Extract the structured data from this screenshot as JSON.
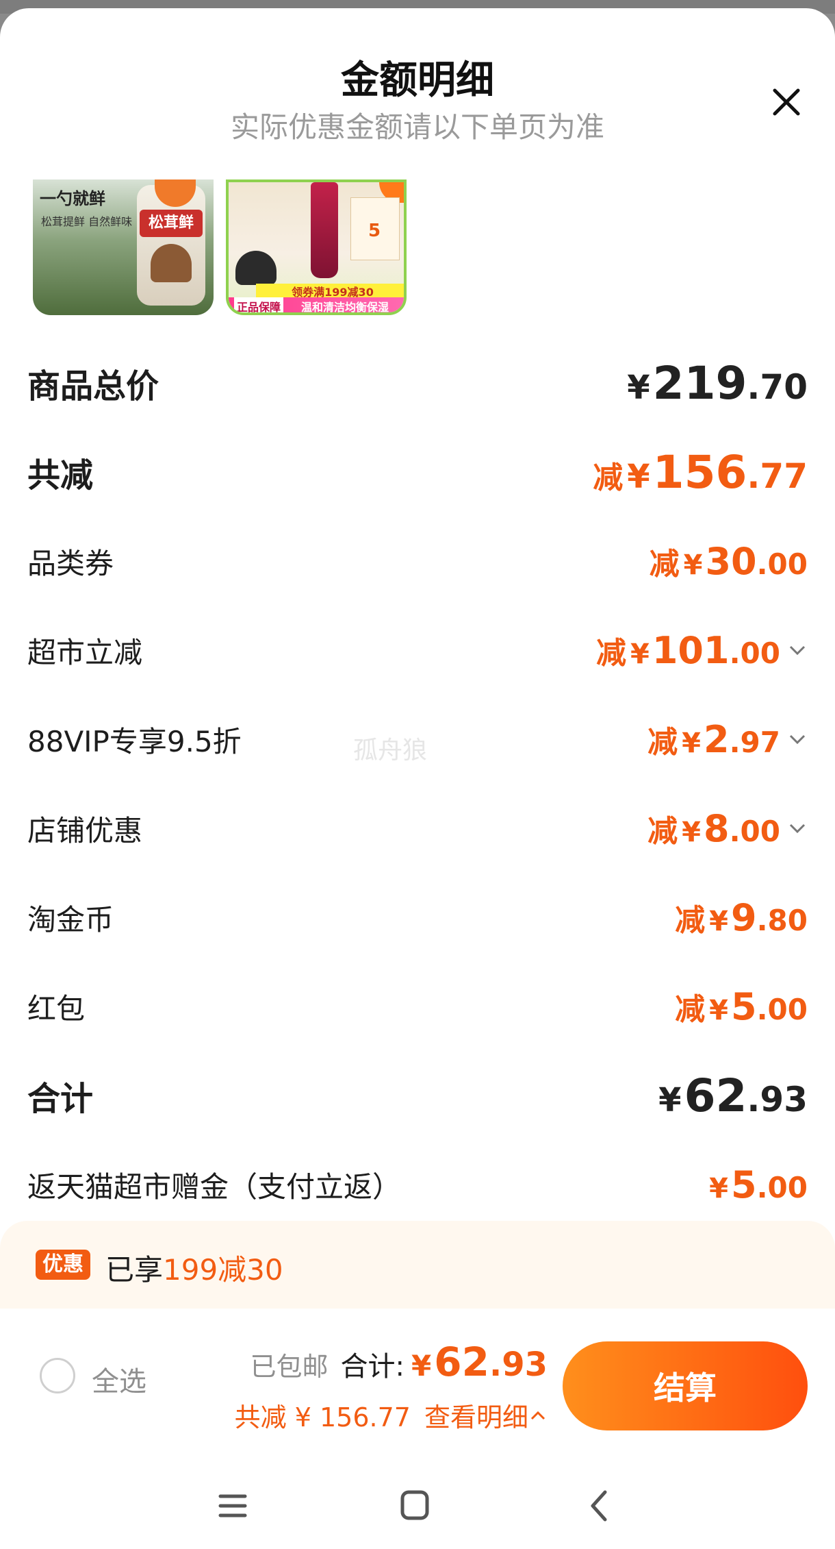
{
  "header": {
    "title": "金额明细",
    "subtitle": "实际优惠金额请以下单页为准"
  },
  "thumbnails": {
    "item1": {
      "label": "一勺就鲜",
      "sub": "松茸提鲜 自然鲜味",
      "product": "松茸鲜"
    },
    "item2": {
      "coupon_value": "5",
      "band": "领券满199减30",
      "tag": "正品保障",
      "slogan": "温和清洁均衡保湿"
    }
  },
  "rows": [
    {
      "label": "商品总价",
      "prefix": "",
      "yen": "¥",
      "int": "219",
      "dec": ".70"
    },
    {
      "label": "共减",
      "prefix": "减",
      "yen": "¥",
      "int": "156",
      "dec": ".77"
    },
    {
      "label": "品类券",
      "prefix": "减",
      "yen": "¥",
      "int": "30",
      "dec": ".00"
    },
    {
      "label": "超市立减",
      "prefix": "减",
      "yen": "¥",
      "int": "101",
      "dec": ".00"
    },
    {
      "label": "88VIP专享9.5折",
      "prefix": "减",
      "yen": "¥",
      "int": "2",
      "dec": ".97"
    },
    {
      "label": "店铺优惠",
      "prefix": "减",
      "yen": "¥",
      "int": "8",
      "dec": ".00"
    },
    {
      "label": "淘金币",
      "prefix": "减",
      "yen": "¥",
      "int": "9",
      "dec": ".80"
    },
    {
      "label": "红包",
      "prefix": "减",
      "yen": "¥",
      "int": "5",
      "dec": ".00"
    },
    {
      "label": "合计",
      "prefix": "",
      "yen": "¥",
      "int": "62",
      "dec": ".93"
    },
    {
      "label": "返天猫超市赠金（支付立返）",
      "prefix": "",
      "yen": "¥",
      "int": "5",
      "dec": ".00"
    }
  ],
  "watermark": "孤舟狼",
  "promo": {
    "tag": "优惠",
    "text": "已享",
    "highlight": "199减30"
  },
  "checkout": {
    "select_all": "全选",
    "shipping": "已包邮",
    "total_label": "合计:",
    "total_yen": "¥",
    "total_int": "62",
    "total_dec": ".93",
    "discount_text": "共减 ¥ 156.77",
    "detail_link": "查看明细",
    "button": "结算"
  },
  "nav": {
    "icons": [
      "menu-icon",
      "home-square-icon",
      "back-chevron-icon"
    ]
  },
  "colors": {
    "accent": "#f25c12",
    "promo_bg": "#fff8ef",
    "button_start": "#ff8f1c",
    "button_end": "#ff4f0e"
  }
}
